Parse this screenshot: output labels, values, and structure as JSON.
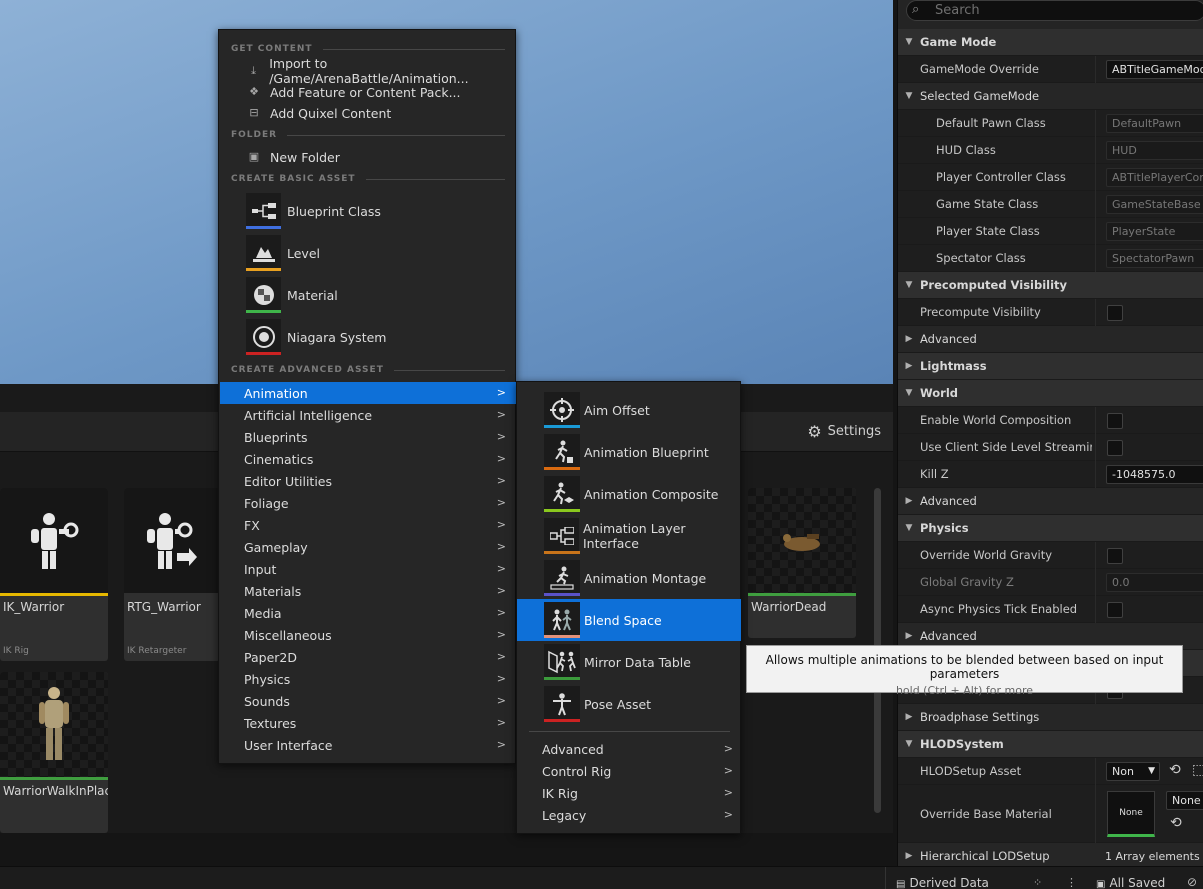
{
  "content_browser": {
    "settings_label": "Settings",
    "assets": [
      {
        "name": "IK_Warrior",
        "type": "IK Rig",
        "bar_color": "#e6b800"
      },
      {
        "name": "RTG_Warrior",
        "type": "IK Retargeter",
        "bar_color": ""
      },
      {
        "name": "WarriorDead",
        "type": "",
        "bar_color": "#3f9e3f"
      },
      {
        "name": "WarriorWalkInPlace",
        "type": "",
        "bar_color": "#3f9e3f"
      }
    ]
  },
  "context_menu": {
    "get_content_header": "GET CONTENT",
    "import_label": "Import to /Game/ArenaBattle/Animation...",
    "add_feature_label": "Add Feature or Content Pack...",
    "add_quixel_label": "Add Quixel Content",
    "folder_header": "FOLDER",
    "new_folder_label": "New Folder",
    "basic_header": "CREATE BASIC ASSET",
    "basic_assets": [
      {
        "label": "Blueprint Class",
        "color": "#3f6fe0"
      },
      {
        "label": "Level",
        "color": "#e8a020"
      },
      {
        "label": "Material",
        "color": "#3fb54a"
      },
      {
        "label": "Niagara System",
        "color": "#cc2222"
      }
    ],
    "advanced_header": "CREATE ADVANCED ASSET",
    "submenus": [
      "Animation",
      "Artificial Intelligence",
      "Blueprints",
      "Cinematics",
      "Editor Utilities",
      "Foliage",
      "FX",
      "Gameplay",
      "Input",
      "Materials",
      "Media",
      "Miscellaneous",
      "Paper2D",
      "Physics",
      "Sounds",
      "Textures",
      "User Interface"
    ],
    "selected_submenu": "Animation"
  },
  "animation_submenu": {
    "assets": [
      {
        "label": "Aim Offset",
        "color": "#1a9ad6"
      },
      {
        "label": "Animation Blueprint",
        "color": "#d96a10"
      },
      {
        "label": "Animation Composite",
        "color": "#8ac81e"
      },
      {
        "label": "Animation Layer Interface",
        "color": "#c8741a"
      },
      {
        "label": "Animation Montage",
        "color": "#5a52c8"
      },
      {
        "label": "Blend Space",
        "color": "#e3917a"
      },
      {
        "label": "Mirror Data Table",
        "color": "#3b9a3b"
      },
      {
        "label": "Pose Asset",
        "color": "#cc2222"
      }
    ],
    "selected": "Blend Space",
    "submenus": [
      "Advanced",
      "Control Rig",
      "IK Rig",
      "Legacy"
    ]
  },
  "tooltip": {
    "text": "Allows multiple animations to be blended between based on input parameters",
    "hint": "hold (Ctrl + Alt) for more"
  },
  "details": {
    "search_placeholder": "Search",
    "game_mode": "Game Mode",
    "gamemode_override_label": "GameMode Override",
    "gamemode_override_value": "ABTitleGameMode",
    "selected_gamemode": "Selected GameMode",
    "default_pawn_label": "Default Pawn Class",
    "default_pawn_value": "DefaultPawn",
    "hud_label": "HUD Class",
    "hud_value": "HUD",
    "player_controller_label": "Player Controller Class",
    "player_controller_value": "ABTitlePlayerController",
    "game_state_label": "Game State Class",
    "game_state_value": "GameStateBase",
    "player_state_label": "Player State Class",
    "player_state_value": "PlayerState",
    "spectator_label": "Spectator Class",
    "spectator_value": "SpectatorPawn",
    "precomputed_visibility": "Precomputed Visibility",
    "precompute_visibility_label": "Precompute Visibility",
    "advanced": "Advanced",
    "lightmass": "Lightmass",
    "world": "World",
    "enable_world_composition": "Enable World Composition",
    "use_client_streaming": "Use Client Side Level Streaming...",
    "kill_z_label": "Kill Z",
    "kill_z_value": "-1048575.0",
    "physics": "Physics",
    "override_world_gravity": "Override World Gravity",
    "global_gravity_label": "Global Gravity Z",
    "global_gravity_value": "0.0",
    "async_physics": "Async Physics Tick Enabled",
    "broadphase": "Broadphase Settings",
    "hlod_system": "HLODSystem",
    "hlod_setup_label": "HLODSetup Asset",
    "hlod_setup_value": "Non",
    "override_base_material": "Override Base Material",
    "none_label": "None",
    "none_value": "None",
    "hierarchical_lod": "Hierarchical LODSetup",
    "array_elements": "1 Array elements"
  },
  "statusbar": {
    "derived_data": "Derived Data",
    "all_saved": "All Saved"
  }
}
